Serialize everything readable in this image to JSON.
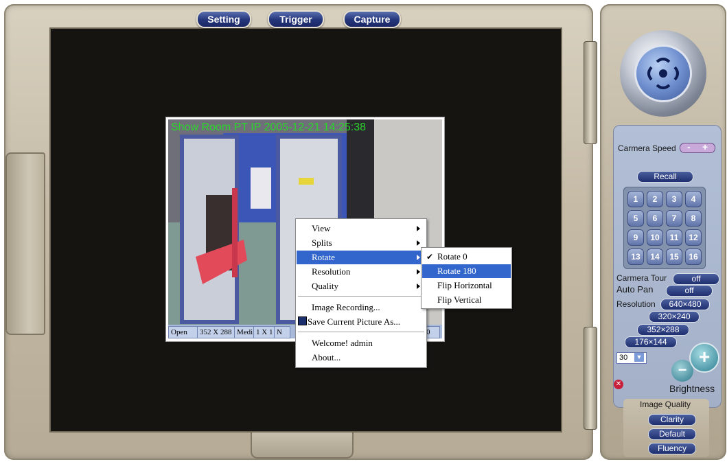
{
  "top_buttons": {
    "setting": "Setting",
    "trigger": "Trigger",
    "capture": "Capture"
  },
  "video": {
    "osd_text": "Show Room PT IP  2005-12-21  14:25:38",
    "status_bar": [
      "Open",
      "352 X 288",
      "Medi",
      "1 X 1",
      "N",
      "0"
    ]
  },
  "context_menu": {
    "items": [
      {
        "label": "View",
        "submenu": true
      },
      {
        "label": "Splits",
        "submenu": true
      },
      {
        "label": "Rotate",
        "submenu": true,
        "selected": true
      },
      {
        "label": "Resolution",
        "submenu": true
      },
      {
        "label": "Quality",
        "submenu": true
      },
      {
        "label": "Image Recording..."
      },
      {
        "label": "Save Current Picture As..."
      },
      {
        "label": "Welcome! admin"
      },
      {
        "label": "About..."
      }
    ],
    "rotate_submenu": [
      {
        "label": "Rotate 0",
        "checked": true
      },
      {
        "label": "Rotate 180",
        "selected": true
      },
      {
        "label": "Flip Horizontal"
      },
      {
        "label": "Flip Vertical"
      }
    ]
  },
  "panel": {
    "camera_speed_label": "Carmera Speed",
    "speed_minus": "-",
    "speed_plus": "+",
    "recall_label": "Recall",
    "presets": [
      "1",
      "2",
      "3",
      "4",
      "5",
      "6",
      "7",
      "8",
      "9",
      "10",
      "11",
      "12",
      "13",
      "14",
      "15",
      "16"
    ],
    "camera_tour_label": "Carmera Tour",
    "camera_tour_value": "off",
    "auto_pan_label": "Auto Pan",
    "auto_pan_value": "off",
    "resolution_label": "Resolution",
    "resolutions": [
      "640×480",
      "320×240",
      "352×288",
      "176×144"
    ],
    "fps_value": "30",
    "brightness_label": "Brightness",
    "brightness_minus": "−",
    "brightness_plus": "+",
    "image_quality_label": "Image Quality",
    "quality_options": [
      "Clarity",
      "Default",
      "Fluency"
    ]
  },
  "colors": {
    "accent_blue": "#1f2f70",
    "menu_highlight": "#3366cc",
    "osd_green": "#2bd62b"
  }
}
